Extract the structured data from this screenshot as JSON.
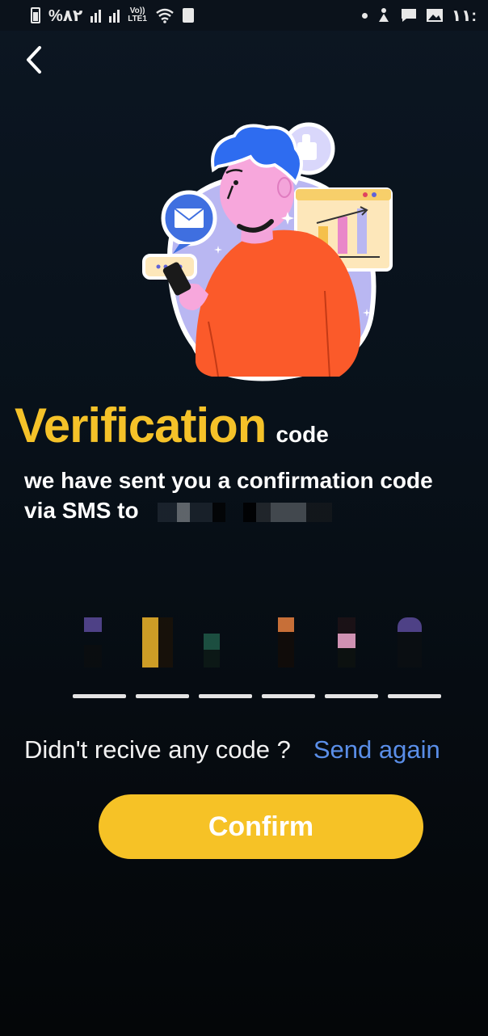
{
  "status_bar": {
    "battery_percent": "%۸۲",
    "volte": "Vo))",
    "network": "LTE1",
    "time": "۱۱:"
  },
  "header": {
    "back_icon": "chevron-left-icon"
  },
  "page": {
    "title": "Verification",
    "title_suffix": "code",
    "message_line1": "we have sent you a confirmation code",
    "message_line2": "via SMS to"
  },
  "code_input": {
    "length": 6
  },
  "resend": {
    "label": "Didn't recive any code ?",
    "link": "Send again"
  },
  "actions": {
    "confirm_label": "Confirm"
  },
  "colors": {
    "accent": "#f6c226",
    "link": "#5a8ee8",
    "background": "#08111a"
  }
}
